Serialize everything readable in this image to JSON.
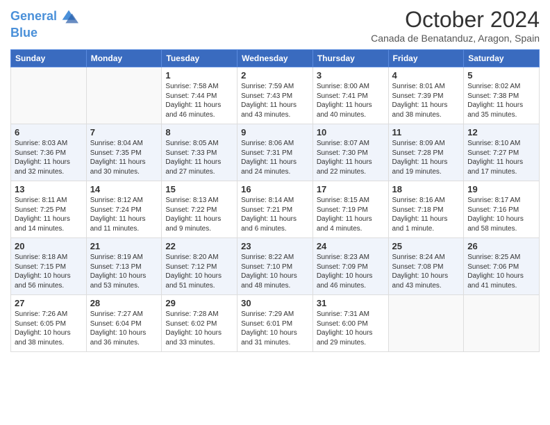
{
  "logo": {
    "line1": "General",
    "line2": "Blue"
  },
  "title": "October 2024",
  "location": "Canada de Benatanduz, Aragon, Spain",
  "headers": [
    "Sunday",
    "Monday",
    "Tuesday",
    "Wednesday",
    "Thursday",
    "Friday",
    "Saturday"
  ],
  "weeks": [
    [
      {
        "day": "",
        "info": ""
      },
      {
        "day": "",
        "info": ""
      },
      {
        "day": "1",
        "info": "Sunrise: 7:58 AM\nSunset: 7:44 PM\nDaylight: 11 hours and 46 minutes."
      },
      {
        "day": "2",
        "info": "Sunrise: 7:59 AM\nSunset: 7:43 PM\nDaylight: 11 hours and 43 minutes."
      },
      {
        "day": "3",
        "info": "Sunrise: 8:00 AM\nSunset: 7:41 PM\nDaylight: 11 hours and 40 minutes."
      },
      {
        "day": "4",
        "info": "Sunrise: 8:01 AM\nSunset: 7:39 PM\nDaylight: 11 hours and 38 minutes."
      },
      {
        "day": "5",
        "info": "Sunrise: 8:02 AM\nSunset: 7:38 PM\nDaylight: 11 hours and 35 minutes."
      }
    ],
    [
      {
        "day": "6",
        "info": "Sunrise: 8:03 AM\nSunset: 7:36 PM\nDaylight: 11 hours and 32 minutes."
      },
      {
        "day": "7",
        "info": "Sunrise: 8:04 AM\nSunset: 7:35 PM\nDaylight: 11 hours and 30 minutes."
      },
      {
        "day": "8",
        "info": "Sunrise: 8:05 AM\nSunset: 7:33 PM\nDaylight: 11 hours and 27 minutes."
      },
      {
        "day": "9",
        "info": "Sunrise: 8:06 AM\nSunset: 7:31 PM\nDaylight: 11 hours and 24 minutes."
      },
      {
        "day": "10",
        "info": "Sunrise: 8:07 AM\nSunset: 7:30 PM\nDaylight: 11 hours and 22 minutes."
      },
      {
        "day": "11",
        "info": "Sunrise: 8:09 AM\nSunset: 7:28 PM\nDaylight: 11 hours and 19 minutes."
      },
      {
        "day": "12",
        "info": "Sunrise: 8:10 AM\nSunset: 7:27 PM\nDaylight: 11 hours and 17 minutes."
      }
    ],
    [
      {
        "day": "13",
        "info": "Sunrise: 8:11 AM\nSunset: 7:25 PM\nDaylight: 11 hours and 14 minutes."
      },
      {
        "day": "14",
        "info": "Sunrise: 8:12 AM\nSunset: 7:24 PM\nDaylight: 11 hours and 11 minutes."
      },
      {
        "day": "15",
        "info": "Sunrise: 8:13 AM\nSunset: 7:22 PM\nDaylight: 11 hours and 9 minutes."
      },
      {
        "day": "16",
        "info": "Sunrise: 8:14 AM\nSunset: 7:21 PM\nDaylight: 11 hours and 6 minutes."
      },
      {
        "day": "17",
        "info": "Sunrise: 8:15 AM\nSunset: 7:19 PM\nDaylight: 11 hours and 4 minutes."
      },
      {
        "day": "18",
        "info": "Sunrise: 8:16 AM\nSunset: 7:18 PM\nDaylight: 11 hours and 1 minute."
      },
      {
        "day": "19",
        "info": "Sunrise: 8:17 AM\nSunset: 7:16 PM\nDaylight: 10 hours and 58 minutes."
      }
    ],
    [
      {
        "day": "20",
        "info": "Sunrise: 8:18 AM\nSunset: 7:15 PM\nDaylight: 10 hours and 56 minutes."
      },
      {
        "day": "21",
        "info": "Sunrise: 8:19 AM\nSunset: 7:13 PM\nDaylight: 10 hours and 53 minutes."
      },
      {
        "day": "22",
        "info": "Sunrise: 8:20 AM\nSunset: 7:12 PM\nDaylight: 10 hours and 51 minutes."
      },
      {
        "day": "23",
        "info": "Sunrise: 8:22 AM\nSunset: 7:10 PM\nDaylight: 10 hours and 48 minutes."
      },
      {
        "day": "24",
        "info": "Sunrise: 8:23 AM\nSunset: 7:09 PM\nDaylight: 10 hours and 46 minutes."
      },
      {
        "day": "25",
        "info": "Sunrise: 8:24 AM\nSunset: 7:08 PM\nDaylight: 10 hours and 43 minutes."
      },
      {
        "day": "26",
        "info": "Sunrise: 8:25 AM\nSunset: 7:06 PM\nDaylight: 10 hours and 41 minutes."
      }
    ],
    [
      {
        "day": "27",
        "info": "Sunrise: 7:26 AM\nSunset: 6:05 PM\nDaylight: 10 hours and 38 minutes."
      },
      {
        "day": "28",
        "info": "Sunrise: 7:27 AM\nSunset: 6:04 PM\nDaylight: 10 hours and 36 minutes."
      },
      {
        "day": "29",
        "info": "Sunrise: 7:28 AM\nSunset: 6:02 PM\nDaylight: 10 hours and 33 minutes."
      },
      {
        "day": "30",
        "info": "Sunrise: 7:29 AM\nSunset: 6:01 PM\nDaylight: 10 hours and 31 minutes."
      },
      {
        "day": "31",
        "info": "Sunrise: 7:31 AM\nSunset: 6:00 PM\nDaylight: 10 hours and 29 minutes."
      },
      {
        "day": "",
        "info": ""
      },
      {
        "day": "",
        "info": ""
      }
    ]
  ]
}
